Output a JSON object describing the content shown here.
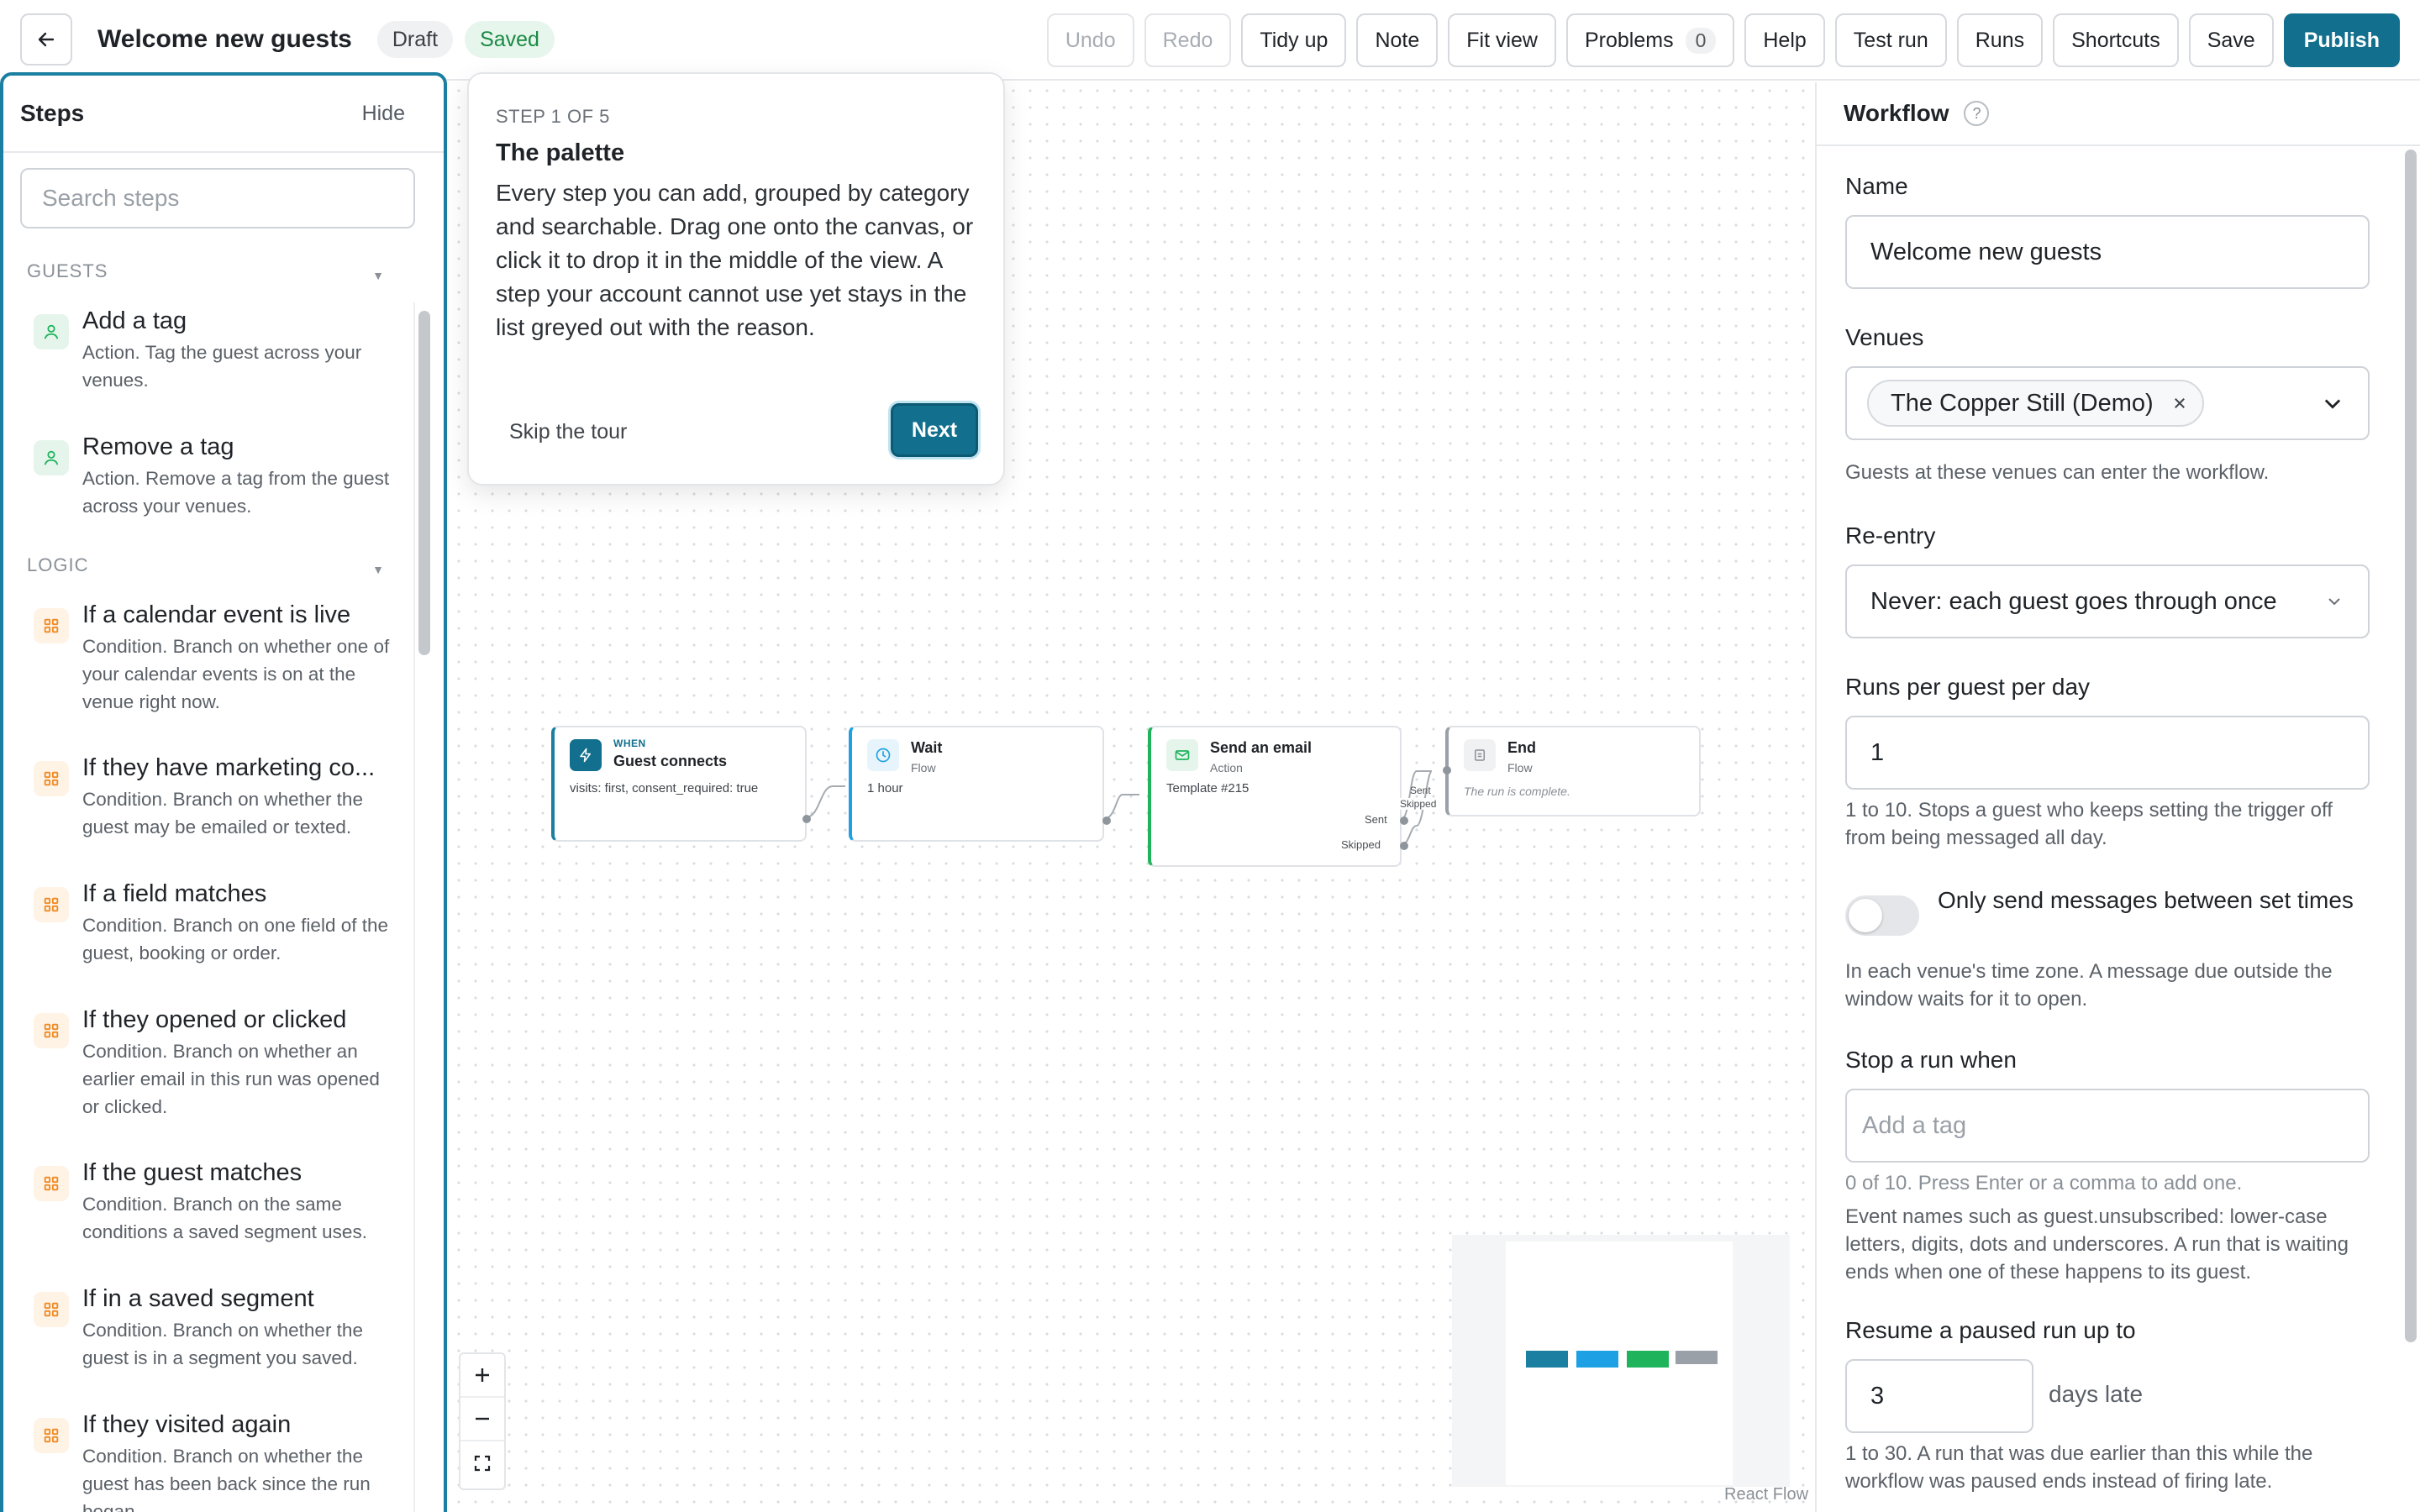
{
  "header": {
    "title": "Welcome new guests",
    "status_draft": "Draft",
    "status_saved": "Saved",
    "buttons": {
      "undo": "Undo",
      "redo": "Redo",
      "tidy": "Tidy up",
      "note": "Note",
      "fit": "Fit view",
      "problems": "Problems",
      "problems_count": "0",
      "help": "Help",
      "test": "Test run",
      "runs": "Runs",
      "shortcuts": "Shortcuts",
      "save": "Save",
      "publish": "Publish"
    }
  },
  "steps_panel": {
    "title": "Steps",
    "hide": "Hide",
    "search_placeholder": "Search steps",
    "categories": [
      {
        "label": "GUESTS",
        "items": [
          {
            "name": "Add a tag",
            "desc": "Action. Tag the guest across your venues.",
            "icon": "person-icon"
          },
          {
            "name": "Remove a tag",
            "desc": "Action. Remove a tag from the guest across your venues.",
            "icon": "person-icon"
          }
        ]
      },
      {
        "label": "LOGIC",
        "items": [
          {
            "name": "If a calendar event is live",
            "desc": "Condition. Branch on whether one of your calendar events is on at the venue right now.",
            "icon": "grid-icon"
          },
          {
            "name": "If they have marketing co...",
            "desc": "Condition. Branch on whether the guest may be emailed or texted.",
            "icon": "grid-icon"
          },
          {
            "name": "If a field matches",
            "desc": "Condition. Branch on one field of the guest, booking or order.",
            "icon": "grid-icon"
          },
          {
            "name": "If they opened or clicked",
            "desc": "Condition. Branch on whether an earlier email in this run was opened or clicked.",
            "icon": "grid-icon"
          },
          {
            "name": "If the guest matches",
            "desc": "Condition. Branch on the same conditions a saved segment uses.",
            "icon": "grid-icon"
          },
          {
            "name": "If in a saved segment",
            "desc": "Condition. Branch on whether the guest is in a segment you saved.",
            "icon": "grid-icon"
          },
          {
            "name": "If they visited again",
            "desc": "Condition. Branch on whether the guest has been back since the run began.",
            "icon": "grid-icon"
          }
        ]
      }
    ]
  },
  "tour": {
    "step": "STEP 1 OF 5",
    "title": "The palette",
    "body": "Every step you can add, grouped by category and searchable. Drag one onto the canvas, or click it to drop it in the middle of the view. A step your account cannot use yet stays in the list greyed out with the reason.",
    "skip": "Skip the tour",
    "next": "Next"
  },
  "canvas": {
    "nodes": {
      "trigger": {
        "over": "WHEN",
        "title": "Guest connects",
        "detail": "visits: first, consent_required: true",
        "icon": "bolt-icon"
      },
      "wait": {
        "title": "Wait",
        "sub": "Flow",
        "detail": "1 hour",
        "icon": "clock-icon"
      },
      "email": {
        "title": "Send an email",
        "sub": "Action",
        "detail": "Template #215",
        "port_sent": "Sent",
        "port_skipped": "Skipped",
        "icon": "mail-icon"
      },
      "end": {
        "title": "End",
        "sub": "Flow",
        "detail": "The run is complete.",
        "icon": "end-icon"
      }
    },
    "edge_labels": {
      "sent": "Sent",
      "skipped": "Skipped"
    },
    "attribution": "React Flow",
    "minimap_colors": [
      "#1a7fa1",
      "#1ea1e4",
      "#1fb45c",
      "#9aa0a7"
    ]
  },
  "workflow_panel": {
    "title": "Workflow",
    "name_label": "Name",
    "name_value": "Welcome new guests",
    "venues_label": "Venues",
    "venue_chip": "The Copper Still (Demo)",
    "venues_hint": "Guests at these venues can enter the workflow.",
    "reentry_label": "Re-entry",
    "reentry_value": "Never: each guest goes through once",
    "runs_label": "Runs per guest per day",
    "runs_value": "1",
    "runs_hint": "1 to 10. Stops a guest who keeps setting the trigger off from being messaged all day.",
    "toggle_label": "Only send messages between set times",
    "toggle_on": false,
    "toggle_hint": "In each venue's time zone. A message due outside the window waits for it to open.",
    "stop_label": "Stop a run when",
    "stop_placeholder": "Add a tag",
    "stop_count": "0 of 10. Press Enter or a comma to add one.",
    "stop_hint": "Event names such as guest.unsubscribed: lower-case letters, digits, dots and underscores. A run that is waiting ends when one of these happens to its guest.",
    "resume_label": "Resume a paused run up to",
    "resume_value": "3",
    "resume_unit": "days late",
    "resume_hint": "1 to 30. A run that was due earlier than this while the workflow was paused ends instead of firing late."
  },
  "colors": {
    "accent": "#12708e",
    "focus": "#1a7fa1",
    "saved_text": "#1a8a44",
    "trigger_edge": "#1a7fa1",
    "wait_edge": "#1ea1e4",
    "email_edge": "#1fb45c",
    "end_edge": "#9aa0a7"
  }
}
